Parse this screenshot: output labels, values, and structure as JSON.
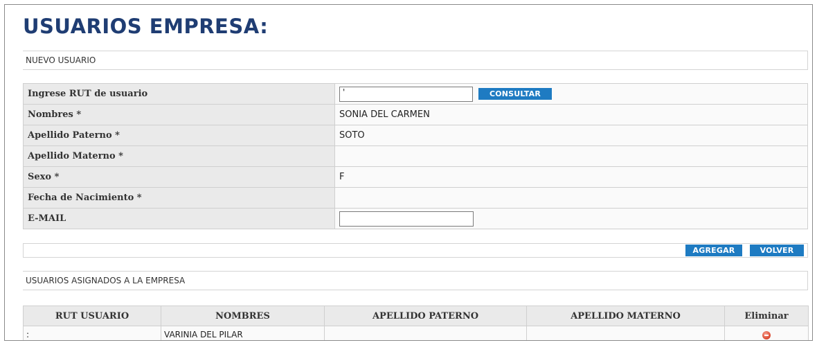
{
  "page_title": "USUARIOS EMPRESA: /",
  "new_user_section": {
    "label": "NUEVO USUARIO"
  },
  "form": {
    "rut_label": "Ingrese RUT de usuario",
    "rut_value": "'",
    "consultar_label": "CONSULTAR",
    "nombres_label": "Nombres *",
    "nombres_value": "SONIA DEL CARMEN",
    "apellido_paterno_label": "Apellido Paterno *",
    "apellido_paterno_value": "SOTO",
    "apellido_materno_label": "Apellido Materno *",
    "apellido_materno_value": "",
    "sexo_label": "Sexo *",
    "sexo_value": "F",
    "fecha_label": "Fecha de Nacimiento *",
    "fecha_value": "",
    "email_label": "E-MAIL",
    "email_value": ""
  },
  "actions": {
    "agregar_label": "AGREGAR",
    "volver_label": "VOLVER"
  },
  "assigned_section": {
    "label": "USUARIOS ASIGNADOS A LA EMPRESA"
  },
  "users_table": {
    "headers": [
      "RUT USUARIO",
      "NOMBRES",
      "APELLIDO PATERNO",
      "APELLIDO MATERNO",
      "Eliminar"
    ],
    "rows": [
      {
        "rut": ":",
        "nombres": "VARINIA DEL PILAR",
        "apellido_paterno": "",
        "apellido_materno": ""
      }
    ]
  },
  "colors": {
    "title": "#1f3d73",
    "button": "#1e7bc2",
    "label_bg": "#eaeaea",
    "delete_icon": "#d9442b"
  }
}
